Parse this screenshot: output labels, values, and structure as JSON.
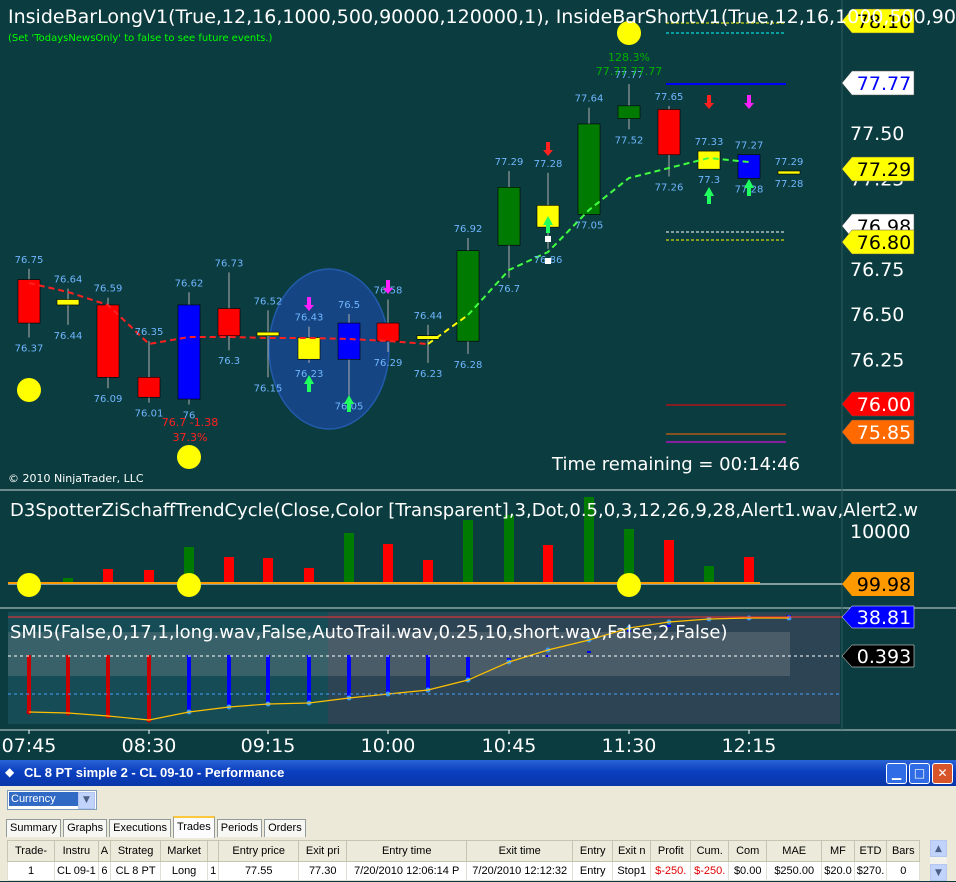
{
  "chart": {
    "price_title": "InsideBarLongV1(True,12,16,1000,500,90000,120000,1),   InsideBarShortV1(True,12,16,1000,500,90",
    "news_note": "(Set 'TodaysNewsOnly' to false to see future events.)",
    "copyright": "© 2010 NinjaTrader, LLC",
    "time_remaining": "Time remaining = 00:14:46",
    "schaff_title": "D3SpotterZiSchaffTrendCycle(Close,Color  [Transparent],3,Dot,0.5,0,3,12,26,9,28,Alert1.wav,Alert2.w",
    "smi_title": "SMI5(False,0,17,1,long.wav,False,AutoTrail.wav,0.25,10,short.wav,False,2,False)",
    "price_axis": [
      "77.50",
      "77.25",
      "76.75",
      "76.50",
      "76.25"
    ],
    "price_tags": [
      {
        "label": "78.10",
        "bg": "#ffff00",
        "fg": "#000000"
      },
      {
        "label": "77.77",
        "bg": "#ffffff",
        "fg": "#0000ff"
      },
      {
        "label": "77.29",
        "bg": "#ffff00",
        "fg": "#000000"
      },
      {
        "label": "76.98",
        "bg": "#ffffff",
        "fg": "#000000"
      },
      {
        "label": "76.80",
        "bg": "#ffff00",
        "fg": "#000000"
      },
      {
        "label": "76.00",
        "bg": "#ff0000",
        "fg": "#ffffff"
      },
      {
        "label": "75.85",
        "bg": "#ff6a00",
        "fg": "#ffffff"
      }
    ],
    "schaff_axis": "10000",
    "schaff_tag": "99.98",
    "smi_tags": [
      {
        "label": "38.81",
        "bg": "#0000ff",
        "fg": "#ffffff"
      },
      {
        "label": "0.393",
        "bg": "#000000",
        "fg": "#ffffff"
      }
    ],
    "time_axis": [
      "07:45",
      "08:30",
      "09:15",
      "10:00",
      "10:45",
      "11:30",
      "12:15"
    ],
    "bar_labels_top": [
      "76.75",
      "76.64",
      "76.59",
      "76.35",
      "76.62",
      "76.73",
      "76.52",
      "76.43",
      "76.5",
      "76.58",
      "76.44",
      "76.92",
      "77.29",
      "77.28",
      "77.64",
      "77.77",
      "77.65",
      "77.33",
      "77.27",
      "77.29"
    ],
    "bar_labels_bottom": [
      "76.37",
      "76.44",
      "76.09",
      "76.01",
      "76",
      "76.3",
      "76.15",
      "76.23",
      "76.05",
      "76.29",
      "76.23",
      "76.28",
      "76.7",
      "76.86",
      "77.05",
      "77.52",
      "77.26",
      "77.3",
      "77.28",
      "77.28"
    ],
    "annotations": {
      "loss_text": "76.7 -1.38",
      "loss_pct": "37.3%",
      "gain_text": "77.77 77.77",
      "gain_pct": "128.3%"
    }
  },
  "window": {
    "title": "CL 8 PT simple 2 - CL 09-10 - Performance",
    "display_unit": "Currency",
    "tabs": [
      "Summary",
      "Graphs",
      "Executions",
      "Trades",
      "Periods",
      "Orders"
    ],
    "active_tab": "Trades",
    "columns": [
      "Trade-",
      "Instru",
      "A",
      "Strateg",
      "Market",
      "",
      "Entry price",
      "Exit pri",
      "Entry time",
      "Exit time",
      "Entry",
      "Exit n",
      "Profit",
      "Cum.",
      "Com",
      "MAE",
      "MF",
      "ETD",
      "Bars"
    ],
    "rows": [
      [
        "1",
        "CL 09-1",
        "6",
        "CL 8 PT",
        "Long",
        "1",
        "77.55",
        "77.30",
        "7/20/2010 12:06:14 P",
        "7/20/2010 12:12:32",
        "Entry",
        "Stop1",
        "$-250.",
        "$-250.",
        "$0.00",
        "$250.00",
        "$20.0",
        "$270.",
        "0"
      ]
    ]
  },
  "colors": {
    "chart_bg": "#0b3c3f",
    "up_bar": "#007a00",
    "down_bar": "#ff0000",
    "inside_bar": "#ffff00",
    "blue_bar": "#0000ff",
    "label": "#6fb6ff"
  }
}
